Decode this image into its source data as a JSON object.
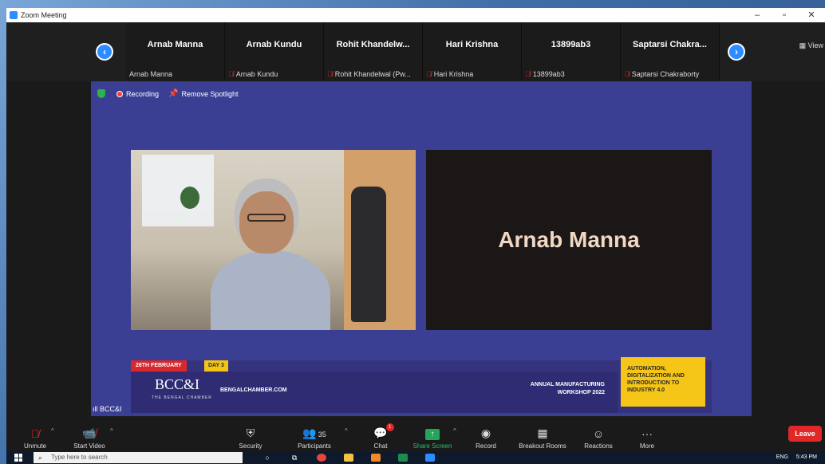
{
  "window": {
    "title": "Zoom Meeting",
    "controls": [
      "–",
      "▫",
      "✕"
    ]
  },
  "strip": {
    "view_label": "▦ View",
    "thumbs": [
      {
        "big": "Arnab Manna",
        "small": "Arnab Manna",
        "muted": false
      },
      {
        "big": "Arnab Kundu",
        "small": "Arnab Kundu",
        "muted": true
      },
      {
        "big": "Rohit Khandelw...",
        "small": "Rohit Khandelwal (Pw...",
        "muted": true
      },
      {
        "big": "Hari Krishna",
        "small": "Hari Krishna",
        "muted": true
      },
      {
        "big": "13899ab3",
        "small": "13899ab3",
        "muted": true
      },
      {
        "big": "Saptarsi Chakra...",
        "small": "Saptarsi Chakraborty",
        "muted": true
      }
    ]
  },
  "stage": {
    "recording_label": "Recording",
    "remove_spotlight_label": "Remove Spotlight",
    "speaker_name": "Arnab Manna",
    "signal_label": "BCC&I"
  },
  "banner": {
    "date": "26TH FEBRUARY",
    "day": "DAY 3",
    "logo": "BCC&I",
    "logo_sub": "THE BENGAL CHAMBER",
    "site": "BENGALCHAMBER.COM",
    "workshop_line1": "ANNUAL MANUFACTURING",
    "workshop_line2": "WORKSHOP 2022",
    "topic": "AUTOMATION, DIGITALIZATION AND INTRODUCTION TO INDUSTRY 4.0"
  },
  "toolbar": {
    "unmute": "Unmute",
    "start_video": "Start Video",
    "security": "Security",
    "participants": "Participants",
    "participants_count": "35",
    "chat": "Chat",
    "chat_badge": "1",
    "share_screen": "Share Screen",
    "record": "Record",
    "breakout": "Breakout Rooms",
    "reactions": "Reactions",
    "more": "More",
    "leave": "Leave"
  },
  "taskbar": {
    "search_placeholder": "Type here to search",
    "lang": "ENG",
    "time": "5:43 PM"
  },
  "colors": {
    "accent": "#2d8cff",
    "stage": "#3b3f93",
    "leave": "#e02828",
    "share": "#23a55a"
  }
}
